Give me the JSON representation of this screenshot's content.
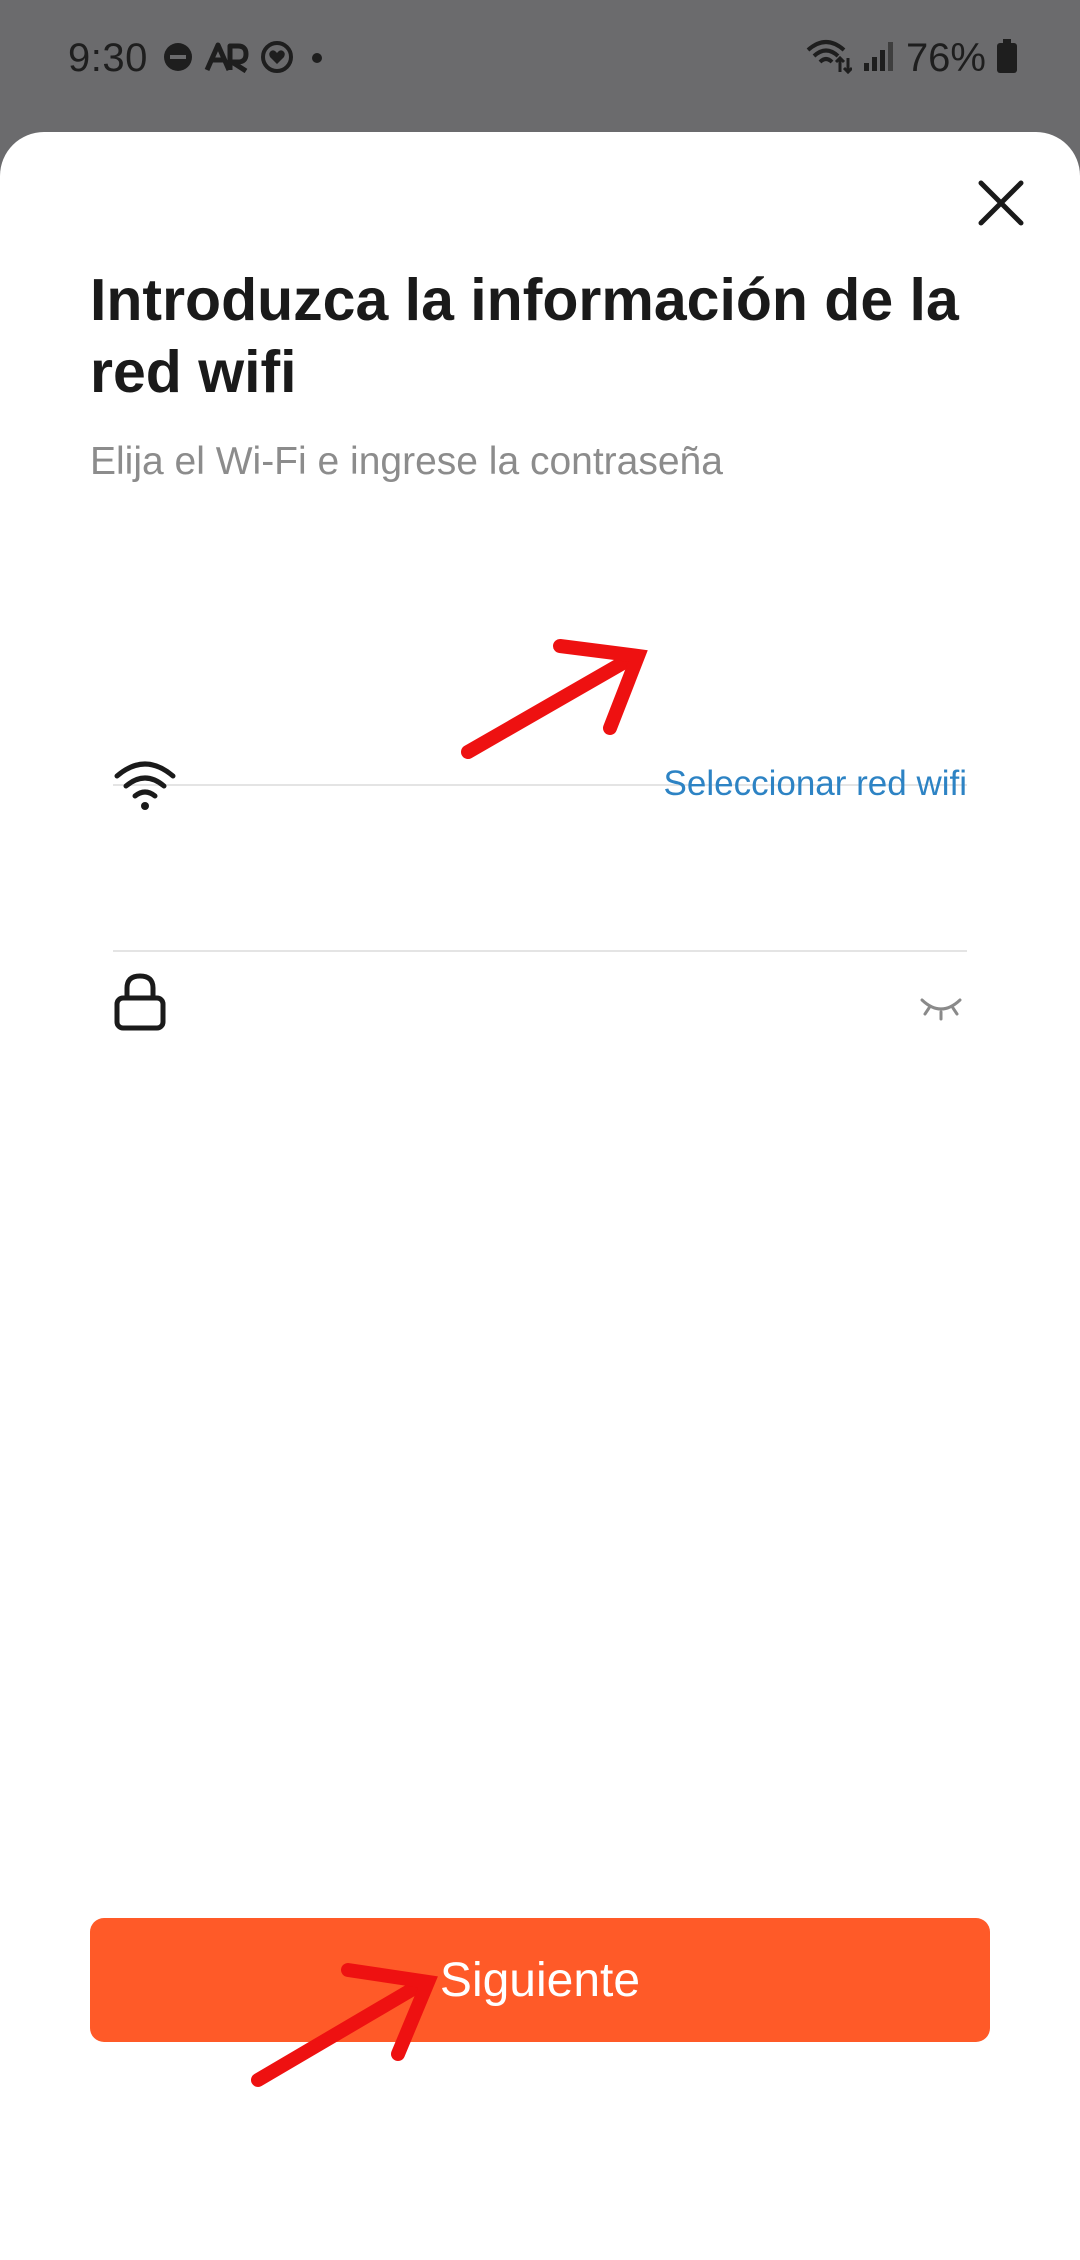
{
  "status_bar": {
    "time": "9:30",
    "battery": "76%",
    "icons_left": [
      "do-not-disturb-icon",
      "ar-icon",
      "heart-circle-icon",
      "dot-icon"
    ],
    "icons_right": [
      "wifi-data-icon",
      "signal-bars-icon",
      "battery-icon"
    ]
  },
  "sheet": {
    "title": "Introduzca la información de la red wifi",
    "subtitle": "Elija el Wi-Fi e ingrese la contraseña",
    "close_icon": "close-icon"
  },
  "wifi_field": {
    "icon": "wifi-icon",
    "value": "",
    "placeholder": "",
    "select_link": "Seleccionar red wifi"
  },
  "password_field": {
    "icon": "lock-icon",
    "value": "",
    "placeholder": "",
    "toggle_icon": "eye-closed-icon"
  },
  "next_button": {
    "label": "Siguiente"
  },
  "colors": {
    "accent": "#ff5a28",
    "link": "#2d83c4",
    "annotation": "#ee1111"
  }
}
